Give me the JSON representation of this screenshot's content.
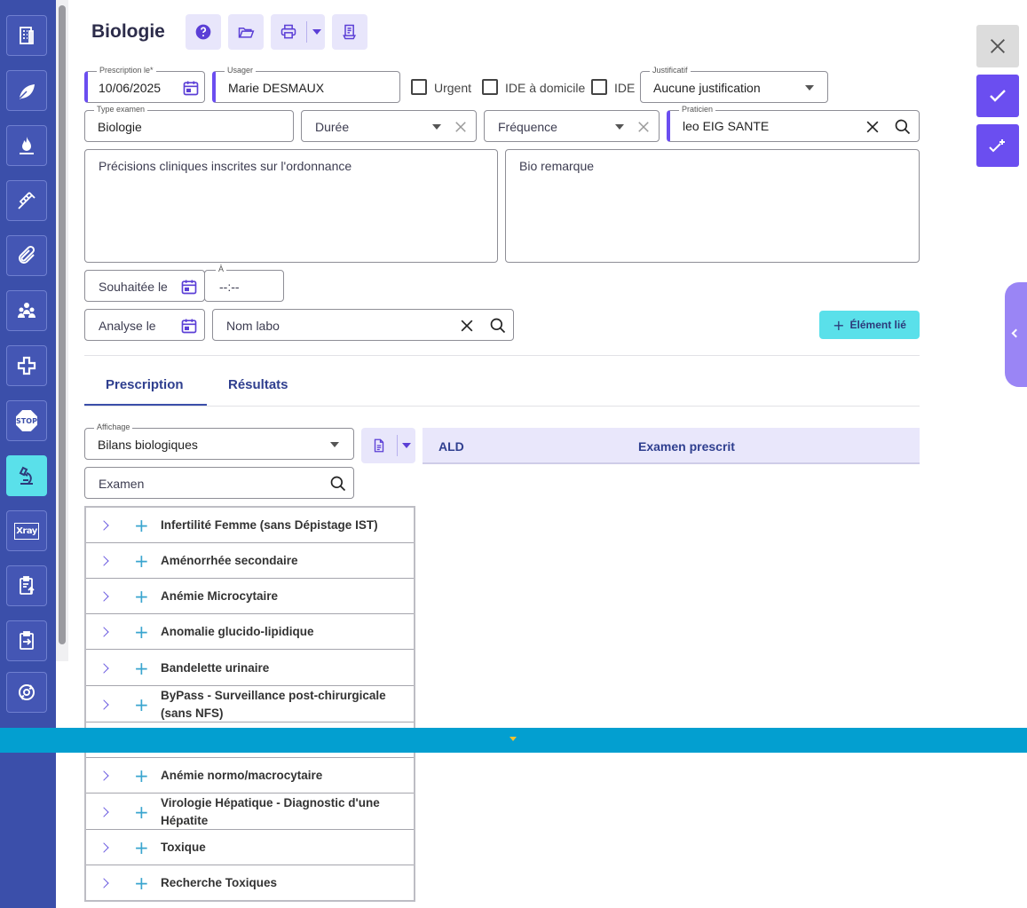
{
  "header": {
    "title": "Biologie",
    "toolbar": [
      "help-icon",
      "folder-open-icon",
      "print-icon",
      "document-icon"
    ]
  },
  "sidebar": {
    "items": [
      {
        "icon": "building-icon"
      },
      {
        "icon": "leaf-icon"
      },
      {
        "icon": "flame-icon"
      },
      {
        "icon": "syringe-icon"
      },
      {
        "icon": "paperclip-icon"
      },
      {
        "icon": "team-icon"
      },
      {
        "icon": "medical-cross-icon"
      },
      {
        "icon": "stop-icon",
        "label": "STOP"
      },
      {
        "icon": "microscope-icon",
        "active": true
      },
      {
        "icon": "xray-icon",
        "label": "Xray"
      },
      {
        "icon": "clipboard-upload-icon"
      },
      {
        "icon": "clipboard-arrow-icon"
      },
      {
        "icon": "sync-icon"
      }
    ]
  },
  "form": {
    "prescription": {
      "label": "Prescription le",
      "required_mark": "*",
      "value": "10/06/2025"
    },
    "usager": {
      "label": "Usager",
      "value": "Marie DESMAUX"
    },
    "urgent": {
      "label": "Urgent",
      "checked": false
    },
    "ide_domicile": {
      "label": "IDE à domicile",
      "checked": false
    },
    "ide": {
      "label": "IDE",
      "checked": false
    },
    "justificatif": {
      "label": "Justificatif",
      "value": "Aucune justification"
    },
    "type_examen": {
      "label": "Type examen",
      "value": "Biologie"
    },
    "duree": {
      "placeholder": "Durée"
    },
    "frequence": {
      "placeholder": "Fréquence"
    },
    "praticien": {
      "label": "Praticien",
      "value": "leo EIG SANTE"
    },
    "precisions": {
      "placeholder": "Précisions cliniques inscrites sur l'ordonnance"
    },
    "bio_remarque": {
      "placeholder": "Bio remarque"
    },
    "souhaitee": {
      "placeholder": "Souhaitée le"
    },
    "heure": {
      "label": "À",
      "placeholder": "--:--"
    },
    "analyse": {
      "placeholder": "Analyse le"
    },
    "nom_labo": {
      "placeholder": "Nom labo"
    },
    "element_lie": {
      "label": "Élément lié"
    }
  },
  "tabs": [
    {
      "label": "Prescription",
      "active": true
    },
    {
      "label": "Résultats",
      "active": false
    }
  ],
  "affichage": {
    "label": "Affichage",
    "value": "Bilans biologiques"
  },
  "examen_search": {
    "placeholder": "Examen"
  },
  "table": {
    "headers": [
      "ALD",
      "Examen prescrit"
    ]
  },
  "bilans": [
    "Infertilité Femme (sans Dépistage IST)",
    "Aménorrhée secondaire",
    "Anémie Microcytaire",
    "Anomalie glucido-lipidique",
    "Bandelette urinaire",
    "ByPass - Surveillance post-chirurgicale (sans NFS)",
    "",
    "Anémie normo/macrocytaire",
    "Virologie Hépatique - Diagnostic d'une Hépatite",
    "Toxique",
    "Recherche Toxiques"
  ],
  "colors": {
    "sidebar": "#3b4faa",
    "accent": "#6b4ef0",
    "cyan": "#5ae0ea",
    "banner": "#039fd0",
    "lavender": "#e8e6fb"
  }
}
